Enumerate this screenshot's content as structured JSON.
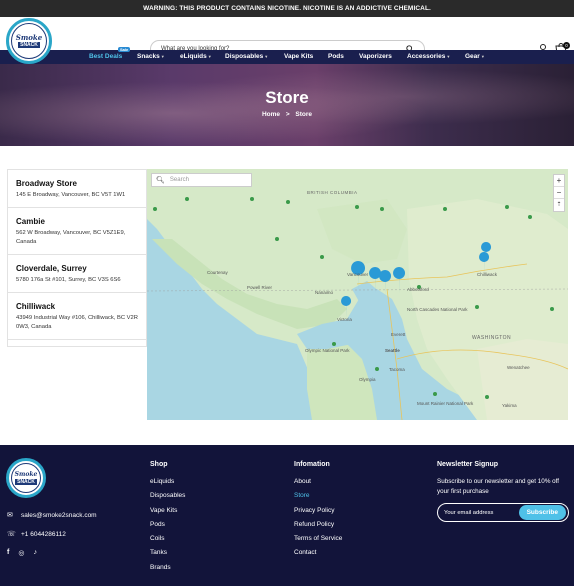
{
  "topbar": {
    "warning": "WARNING: THIS PRODUCT CONTAINS NICOTINE. NICOTINE IS AN ADDICTIVE CHEMICAL."
  },
  "header": {
    "logo_top": "Smoke",
    "logo_bottom": "SNACK",
    "search_placeholder": "What are you looking for?",
    "cart_count": "0"
  },
  "nav": {
    "items": [
      "Best Deals",
      "Snacks",
      "eLiquids",
      "Disposables",
      "Vape Kits",
      "Pods",
      "Vaporizers",
      "Accessories",
      "Gear"
    ],
    "badge": "Sale"
  },
  "hero": {
    "title": "Store",
    "crumb_home": "Home",
    "crumb_sep": ">",
    "crumb_current": "Store"
  },
  "stores": [
    {
      "name": "Broadway Store",
      "address": "145 E Broadway, Vancouver, BC V5T 1W1"
    },
    {
      "name": "Cambie",
      "address": "562 W Broadway, Vancouver, BC V5Z1E9, Canada"
    },
    {
      "name": "Cloverdale, Surrey",
      "address": "5780 176a St #101, Surrey, BC V3S 6S6"
    },
    {
      "name": "Chilliwack",
      "address": "43949 Industrial Way #106, Chilliwack, BC V2R 0W3, Canada"
    }
  ],
  "map": {
    "search_placeholder": "Search",
    "zoom_in": "+",
    "zoom_out": "−",
    "labels": [
      "BRITISH COLUMBIA",
      "WASHINGTON",
      "Vancouver",
      "Victoria",
      "Seattle",
      "Tacoma",
      "Olympia",
      "Everett",
      "Nanaimo",
      "Abbotsford",
      "Chilliwack",
      "Yakima",
      "Olympic National Park",
      "Mount Rainier National Park",
      "North Cascades National Park",
      "Powell River",
      "Wenatchee",
      "Courtenay"
    ]
  },
  "footer": {
    "logo_top": "Smoke",
    "logo_bottom": "SNACK",
    "email": "sales@smoke2snack.com",
    "phone": "+1 6044286112",
    "shop_title": "Shop",
    "shop_links": [
      "eLiquids",
      "Disposables",
      "Vape Kits",
      "Pods",
      "Coils",
      "Tanks",
      "Brands"
    ],
    "info_title": "Infomation",
    "info_links": [
      "About",
      "Store",
      "Privacy Policy",
      "Refund Policy",
      "Terms of Service",
      "Contact"
    ],
    "news_title": "Newsletter Signup",
    "news_text": "Subscribe to our newsletter and get 10% off your first purchase",
    "email_placeholder": "Your email address",
    "subscribe": "Subscribe"
  },
  "colors": {
    "navy": "#1a1f4e",
    "accent": "#4fc1e8",
    "footer_bg": "#12143a",
    "marker": "#2a9ad6"
  }
}
